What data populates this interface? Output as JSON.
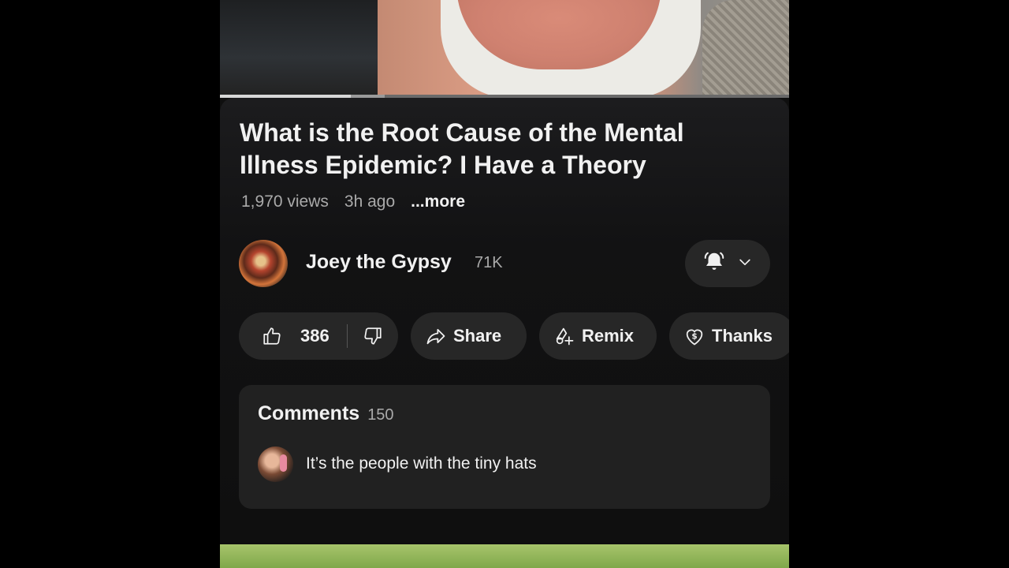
{
  "video": {
    "title": "What is the Root Cause of the Mental Illness Epidemic? I Have a Theory",
    "views": "1,970 views",
    "age": "3h ago",
    "more_label": "...more",
    "progress_fraction": 0.23,
    "buffer_fraction": 0.29
  },
  "channel": {
    "name": "Joey the Gypsy",
    "subscribers": "71K",
    "avatar_icon": "channel-avatar",
    "bell_icon": "bell-ringing-icon",
    "chevron_icon": "chevron-down-icon"
  },
  "actions": {
    "like_count": "386",
    "share_label": "Share",
    "remix_label": "Remix",
    "thanks_label": "Thanks"
  },
  "comments": {
    "label": "Comments",
    "count": "150",
    "top_comment": "It’s the people with the tiny hats"
  },
  "colors": {
    "background": "#0f0f0f",
    "pill": "#272727",
    "text_primary": "#f1f1f1",
    "text_secondary": "#aaaaaa"
  }
}
